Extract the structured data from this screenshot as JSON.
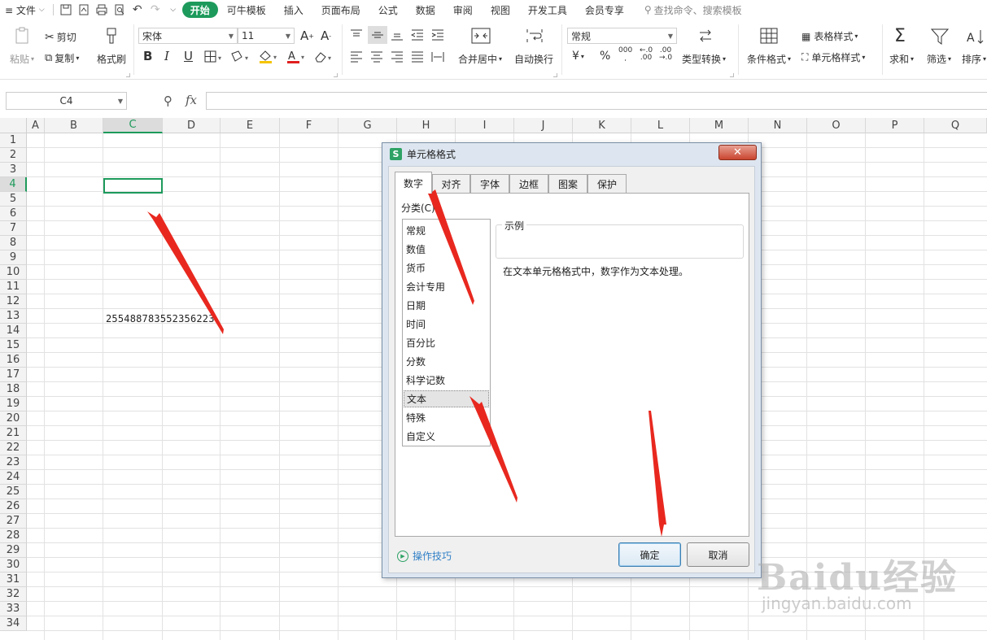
{
  "menubar": {
    "file": "≡ 文件",
    "tabs": [
      "开始",
      "可牛模板",
      "插入",
      "页面布局",
      "公式",
      "数据",
      "审阅",
      "视图",
      "开发工具",
      "会员专享"
    ],
    "search": "查找命令、搜索模板"
  },
  "ribbon": {
    "paste": "粘贴",
    "cut": "剪切",
    "copy": "复制",
    "format_painter": "格式刷",
    "font_name": "宋体",
    "font_size": "11",
    "bold": "B",
    "italic": "I",
    "underline": "U",
    "number_format": "常规",
    "merge_center": "合并居中",
    "wrap_text": "自动换行",
    "currency": "¥",
    "percent": "%",
    "type_convert": "类型转换",
    "conditional_format": "条件格式",
    "table_style": "表格样式",
    "cell_style": "单元格样式",
    "sum": "求和",
    "filter": "筛选",
    "sort": "排序"
  },
  "formula_bar": {
    "name_box": "C4",
    "fx": "fx"
  },
  "grid": {
    "columns": [
      "A",
      "B",
      "C",
      "D",
      "E",
      "F",
      "G",
      "H",
      "I",
      "J",
      "K",
      "L",
      "M",
      "N",
      "O",
      "P",
      "Q"
    ],
    "rows": [
      "1",
      "2",
      "3",
      "4",
      "5",
      "6",
      "7",
      "8",
      "9",
      "10",
      "11",
      "12",
      "13",
      "14",
      "15",
      "16",
      "17",
      "18",
      "19",
      "20",
      "21",
      "22",
      "23",
      "24",
      "25",
      "26",
      "27",
      "28",
      "29",
      "30",
      "31",
      "32",
      "33",
      "34"
    ],
    "selected_column": "C",
    "selected_row": "4",
    "cell_c5": "255488783552356223"
  },
  "dialog": {
    "title": "单元格格式",
    "tabs": [
      "数字",
      "对齐",
      "字体",
      "边框",
      "图案",
      "保护"
    ],
    "category_label": "分类(C):",
    "categories": [
      "常规",
      "数值",
      "货币",
      "会计专用",
      "日期",
      "时间",
      "百分比",
      "分数",
      "科学记数",
      "文本",
      "特殊",
      "自定义"
    ],
    "selected_category": "文本",
    "sample_label": "示例",
    "description": "在文本单元格格式中，数字作为文本处理。",
    "tips": "操作技巧",
    "ok": "确定",
    "cancel": "取消"
  },
  "watermark": {
    "main": "Baidu经验",
    "sub": "jingyan.baidu.com"
  },
  "colors": {
    "accent": "#1d9a5b",
    "arrow": "#e8281f"
  }
}
